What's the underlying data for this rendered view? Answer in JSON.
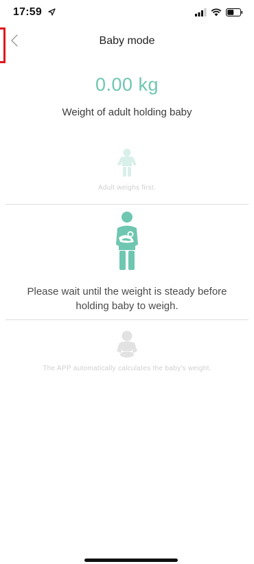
{
  "status_bar": {
    "time": "17:59"
  },
  "nav": {
    "title": "Baby mode"
  },
  "weight": {
    "value": "0.00 kg",
    "caption": "Weight of adult holding baby"
  },
  "steps": [
    {
      "text": "Adult weighs first.",
      "icon": "adult-icon",
      "state": "inactive"
    },
    {
      "text": "Please wait until the weight is steady before holding baby to weigh.",
      "icon": "adult-holding-baby-icon",
      "state": "active"
    },
    {
      "text": "The APP automatically calculates the baby's weight.",
      "icon": "baby-icon",
      "state": "inactive"
    }
  ],
  "colors": {
    "accent": "#6fc6b1",
    "faded_accent": "#d9efe9",
    "faded_gray": "#e2e2e2",
    "marker": "#e0161c"
  }
}
